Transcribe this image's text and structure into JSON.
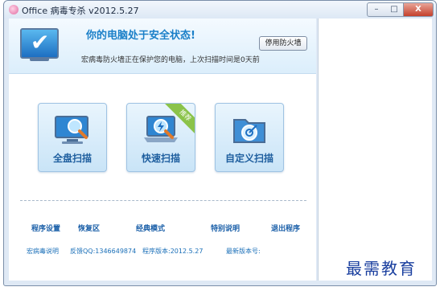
{
  "window": {
    "title": "Office 病毒专杀 v2012.5.27",
    "buttons": {
      "minimize": "–",
      "maximize": "□",
      "close": "X"
    }
  },
  "status": {
    "headline": "你的电脑处于安全状态!",
    "detail": "宏病毒防火墙正在保护您的电脑，上次扫描时间是0天前",
    "firewall_button": "停用防火墙"
  },
  "scan_options": [
    {
      "label": "全盘扫描"
    },
    {
      "label": "快速扫描",
      "badge": "推荐"
    },
    {
      "label": "自定义扫描"
    }
  ],
  "footer_links": [
    "程序设置",
    "恢复区",
    "经典模式",
    "特别说明",
    "退出程序"
  ],
  "info_line": {
    "help": "宏病毒说明",
    "feedback": "反馈QQ:1346649874",
    "version": "程序版本:2012.5.27",
    "latest": "最新版本号:"
  },
  "watermark": "最需教育"
}
